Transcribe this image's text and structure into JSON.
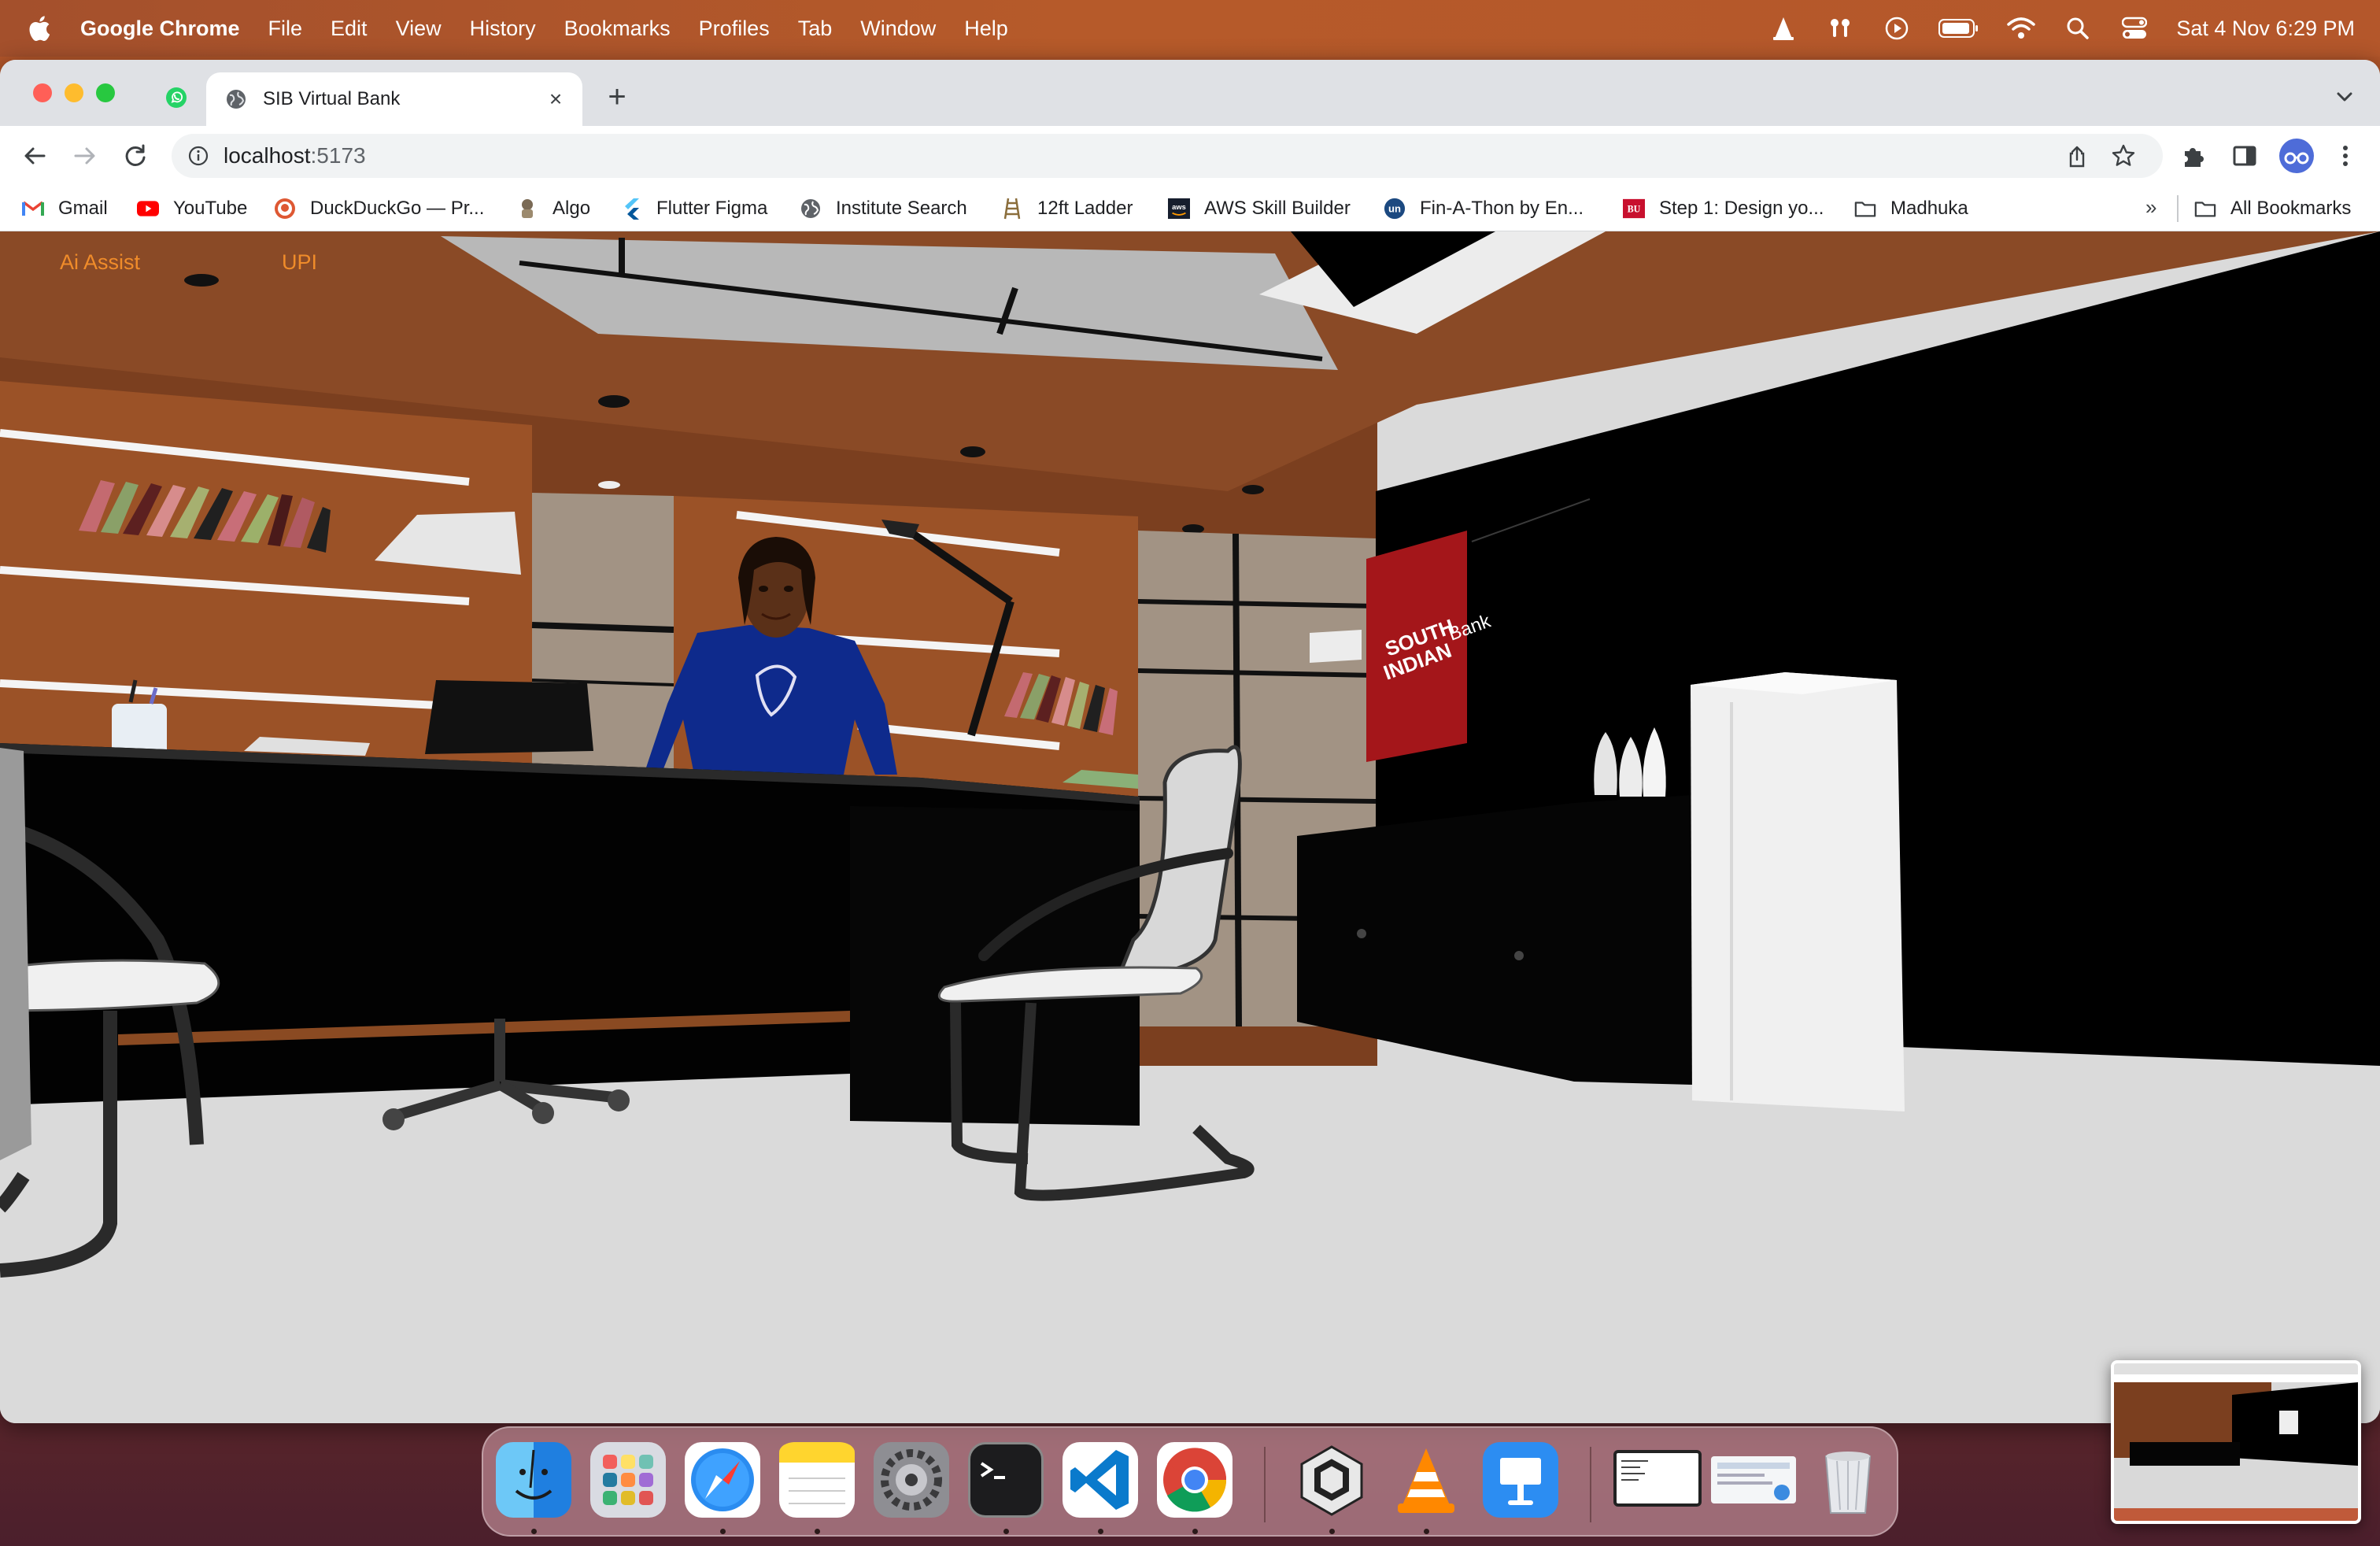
{
  "menubar": {
    "app_name": "Google Chrome",
    "items": [
      "File",
      "Edit",
      "View",
      "History",
      "Bookmarks",
      "Profiles",
      "Tab",
      "Window",
      "Help"
    ],
    "clock": "Sat 4 Nov  6:29 PM",
    "status_icons": [
      "vlc-icon",
      "airpods-icon",
      "play-icon",
      "battery-icon",
      "wifi-icon",
      "spotlight-icon",
      "control-center-icon"
    ]
  },
  "browser": {
    "tab": {
      "title": "SIB Virtual Bank"
    },
    "address": {
      "host": "localhost",
      "port": ":5173"
    },
    "bookmarks": [
      {
        "label": "Gmail",
        "icon": "gmail-icon"
      },
      {
        "label": "YouTube",
        "icon": "youtube-icon"
      },
      {
        "label": "DuckDuckGo — Pr...",
        "icon": "duckduckgo-icon"
      },
      {
        "label": "Algo",
        "icon": "algo-icon"
      },
      {
        "label": "Flutter Figma",
        "icon": "flutter-icon"
      },
      {
        "label": "Institute Search",
        "icon": "globe-icon"
      },
      {
        "label": "12ft Ladder",
        "icon": "ladder-icon"
      },
      {
        "label": "AWS Skill Builder",
        "icon": "aws-icon"
      },
      {
        "label": "Fin-A-Thon by En...",
        "icon": "unstop-icon"
      },
      {
        "label": "Step 1: Design yo...",
        "icon": "bu-icon"
      },
      {
        "label": "Madhuka",
        "icon": "folder-icon"
      }
    ],
    "bookmarks_overflow": "»",
    "all_bookmarks": "All Bookmarks"
  },
  "page": {
    "nav": {
      "ai_assist": "Ai Assist",
      "upi": "UPI"
    },
    "scene": {
      "bank_sign_line1": "SOUTH",
      "bank_sign_line2": "INDIAN",
      "bank_sign_word": "Bank"
    }
  },
  "colors": {
    "accent_orange": "#f08c2a",
    "wall_brown": "#8b4a22",
    "bank_red": "#a4161a"
  },
  "dock": {
    "apps": [
      {
        "name": "finder-icon",
        "running": true
      },
      {
        "name": "launchpad-icon",
        "running": false
      },
      {
        "name": "safari-icon",
        "running": true
      },
      {
        "name": "notes-icon",
        "running": true
      },
      {
        "name": "system-settings-icon",
        "running": false
      },
      {
        "name": "terminal-icon",
        "running": true
      },
      {
        "name": "vscode-icon",
        "running": true
      },
      {
        "name": "chrome-icon",
        "running": true
      },
      {
        "name": "unity-icon",
        "running": true
      },
      {
        "name": "vlc-icon",
        "running": true
      },
      {
        "name": "keynote-icon",
        "running": false
      },
      {
        "name": "window-preview-1",
        "running": false
      },
      {
        "name": "window-preview-2",
        "running": false
      },
      {
        "name": "trash-icon",
        "running": false
      }
    ]
  }
}
